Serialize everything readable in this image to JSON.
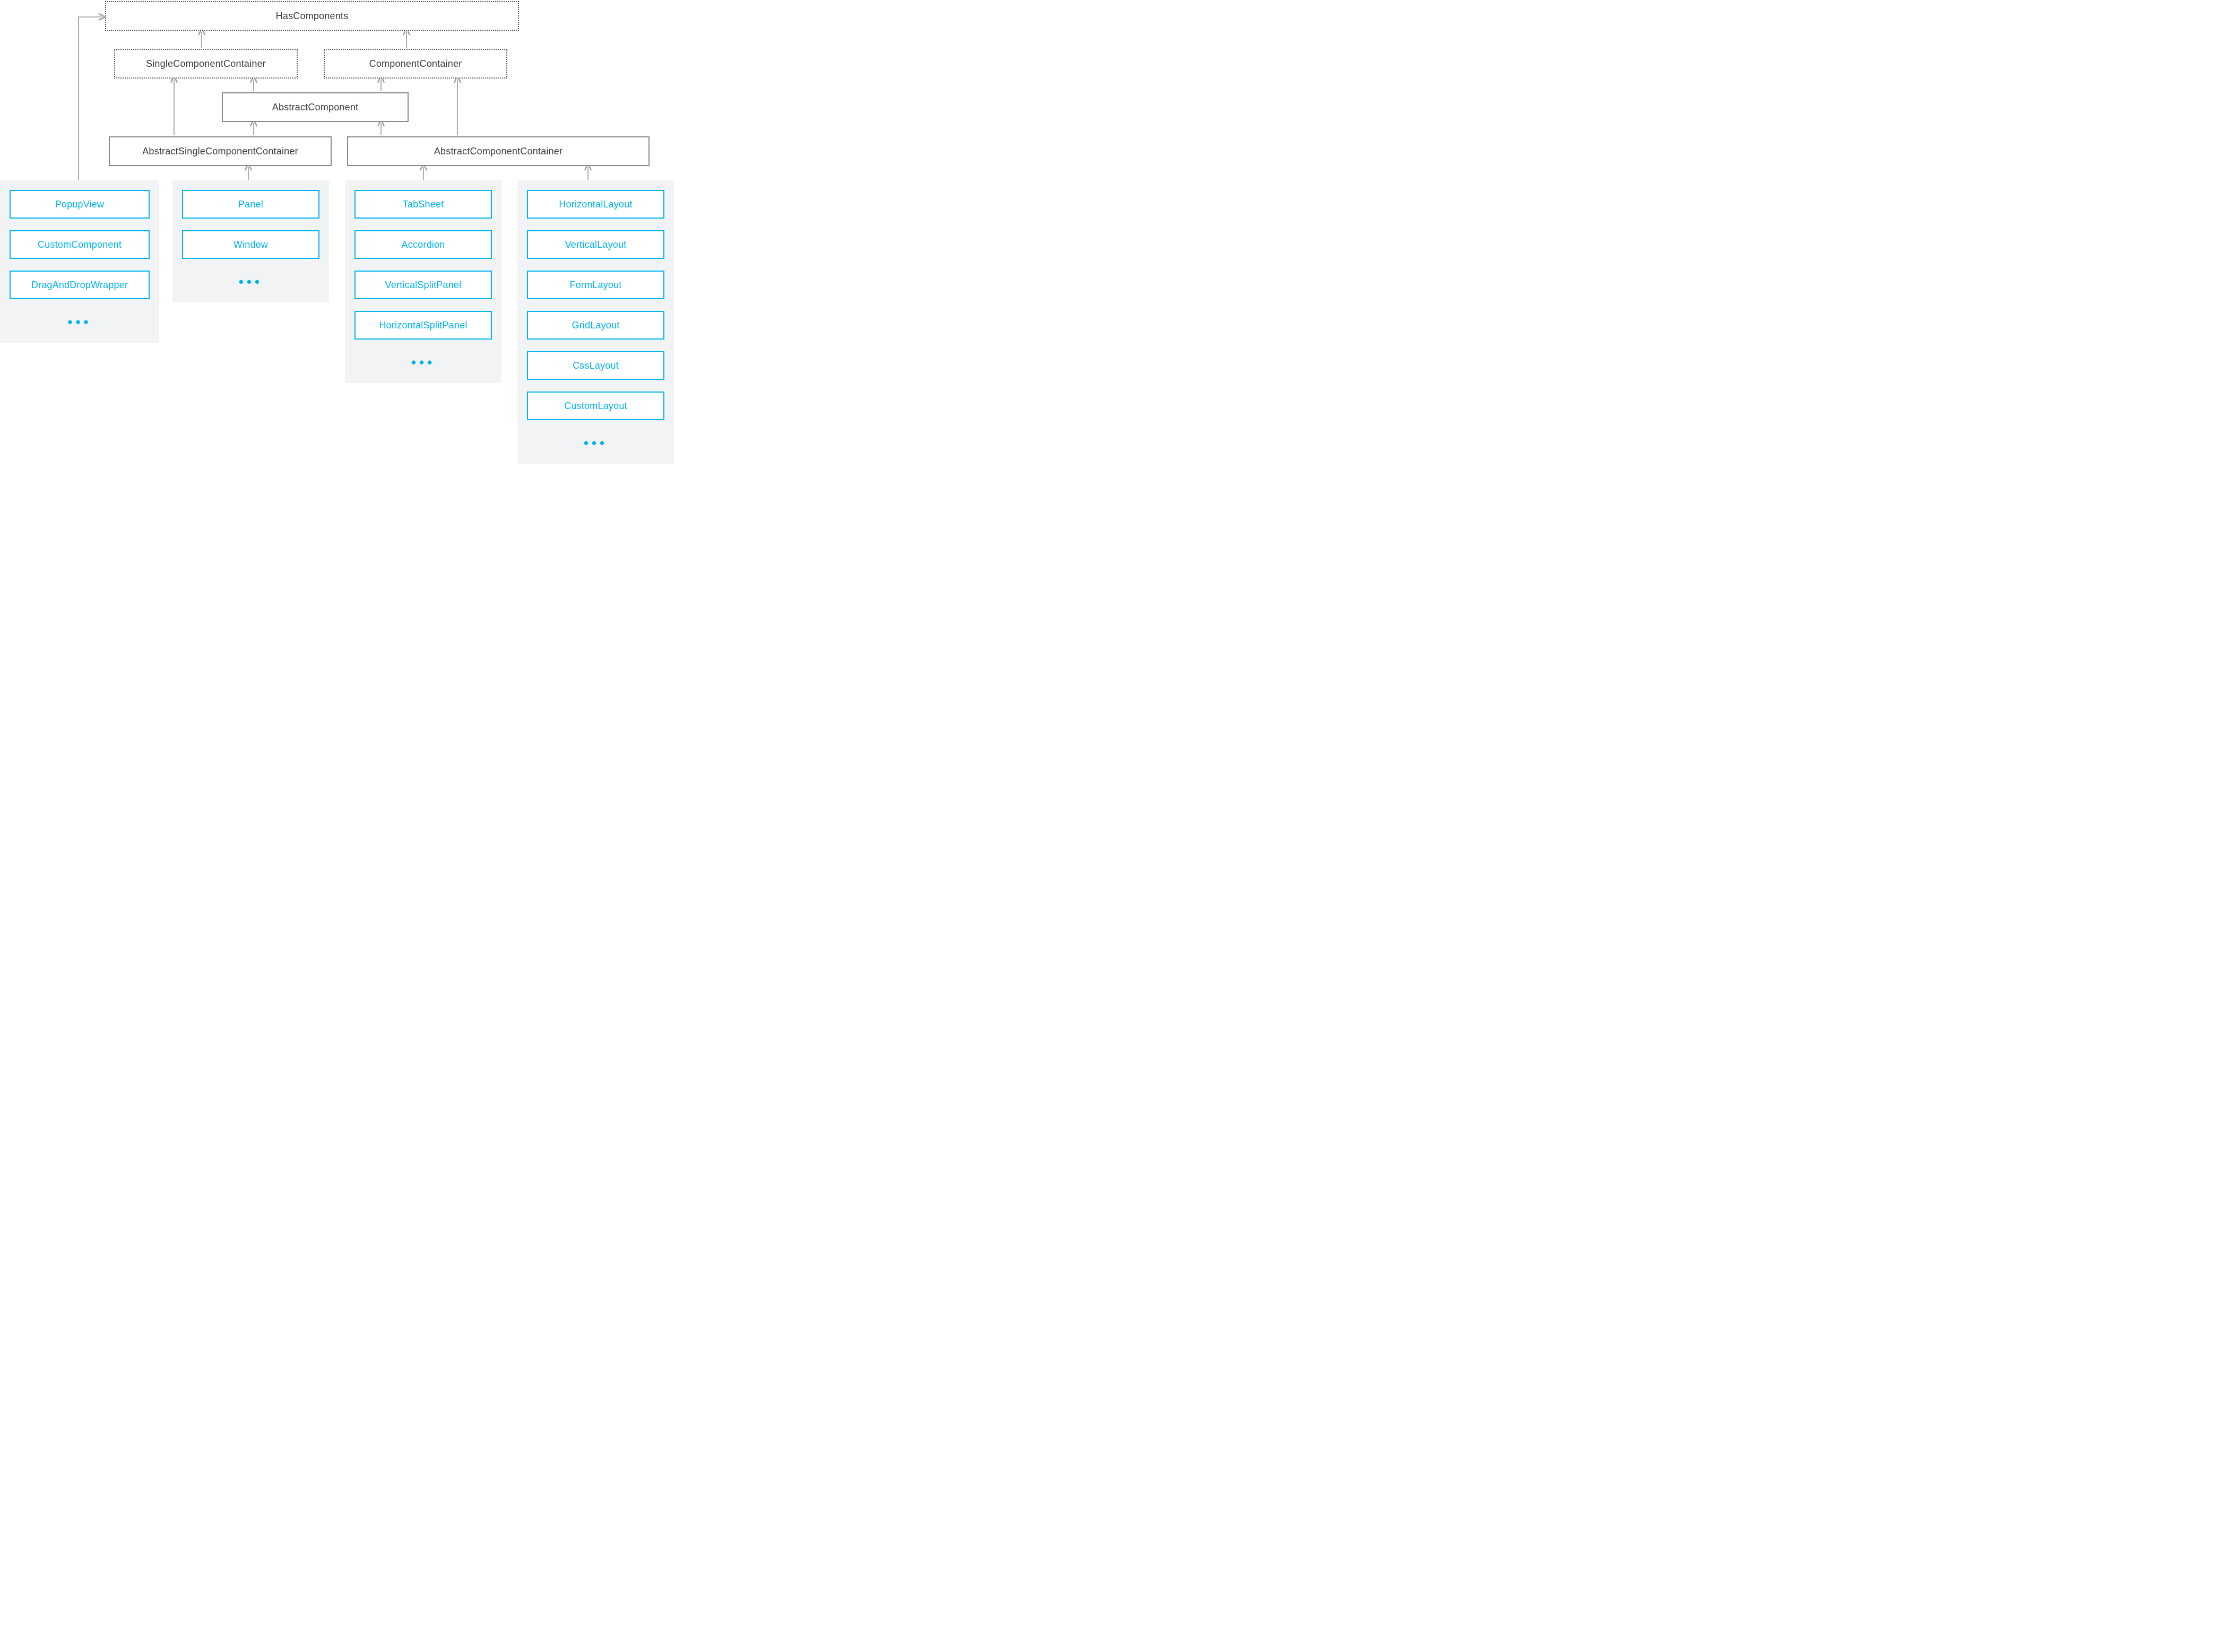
{
  "diagram": {
    "interfaces": {
      "hasComponents": "HasComponents",
      "singleComponentContainer": "SingleComponentContainer",
      "componentContainer": "ComponentContainer"
    },
    "abstracts": {
      "abstractComponent": "AbstractComponent",
      "abstractSingle": "AbstractSingleComponentContainer",
      "abstractContainer": "AbstractComponentContainer"
    },
    "groups": {
      "g1": {
        "items": [
          "PopupView",
          "CustomComponent",
          "DragAndDropWrapper"
        ],
        "more": true
      },
      "g2": {
        "items": [
          "Panel",
          "Window"
        ],
        "more": true
      },
      "g3": {
        "items": [
          "TabSheet",
          "Accordion",
          "VerticalSplitPanel",
          "HorizontalSplitPanel"
        ],
        "more": true
      },
      "g4": {
        "items": [
          "HorizontalLayout",
          "VerticalLayout",
          "FormLayout",
          "GridLayout",
          "CssLayout",
          "CustomLayout"
        ],
        "more": true
      }
    },
    "ellipsis": "•••"
  },
  "colors": {
    "accent": "#00b4f0",
    "box": "#8a8a8a",
    "groupBg": "#f1f3f4"
  }
}
